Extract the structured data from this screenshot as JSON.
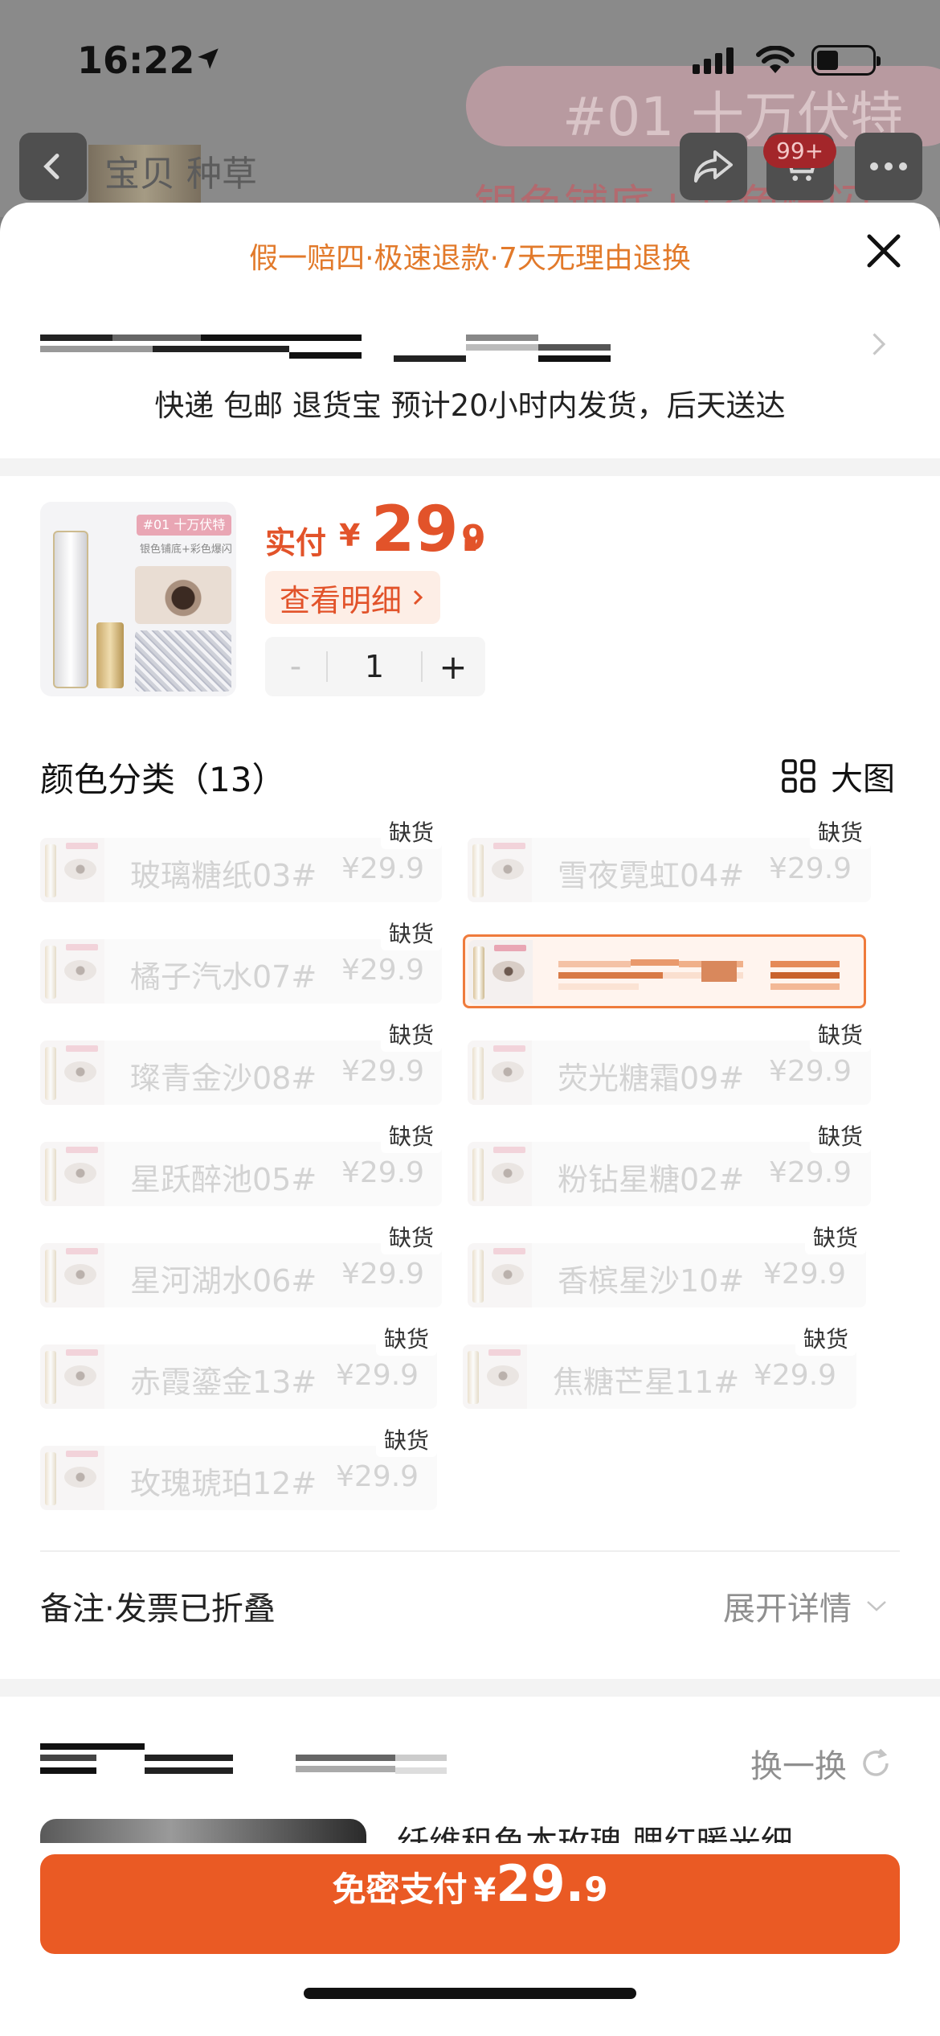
{
  "status_bar": {
    "time": "16:22"
  },
  "background_page": {
    "title": "宝贝 种草",
    "banner_text": "#01 十万伏特",
    "banner_subtext": "银色铺底+彩色爆闪",
    "cart_badge": "99+"
  },
  "sheet": {
    "guarantee": "假一赔四·极速退款·7天无理由退换",
    "delivery": "快递 包邮 退货宝 预计20小时内发货，后天送达",
    "product": {
      "thumb_tag": "#01 十万伏特",
      "thumb_subtag": "银色铺底+彩色爆闪",
      "paid_label": "实付",
      "currency": "¥",
      "price_int": "29.",
      "price_dec": "9",
      "detail_label": "查看明细",
      "quantity": "1",
      "minus": "-",
      "plus": "+"
    },
    "color_section": {
      "title": "颜色分类（13）",
      "big_image_label": "大图",
      "out_of_stock_label": "缺货",
      "options": [
        {
          "name": "玻璃糖纸03#",
          "price": "¥29.9",
          "out_of_stock": true
        },
        {
          "name": "雪夜霓虹04#",
          "price": "¥29.9",
          "out_of_stock": true
        },
        {
          "name": "橘子汽水07#",
          "price": "¥29.9",
          "out_of_stock": true
        },
        {
          "name": "",
          "price": "",
          "out_of_stock": false,
          "selected": true
        },
        {
          "name": "璨青金沙08#",
          "price": "¥29.9",
          "out_of_stock": true
        },
        {
          "name": "荧光糖霜09#",
          "price": "¥29.9",
          "out_of_stock": true
        },
        {
          "name": "星跃醉池05#",
          "price": "¥29.9",
          "out_of_stock": true
        },
        {
          "name": "粉钻星糖02#",
          "price": "¥29.9",
          "out_of_stock": true
        },
        {
          "name": "星河湖水06#",
          "price": "¥29.9",
          "out_of_stock": true
        },
        {
          "name": "香槟星沙10#",
          "price": "¥29.9",
          "out_of_stock": true
        },
        {
          "name": "赤霞鎏金13#",
          "price": "¥29.9",
          "out_of_stock": true
        },
        {
          "name": "焦糖芒星11#",
          "price": "¥29.9",
          "out_of_stock": true
        },
        {
          "name": "玫瑰琥珀12#",
          "price": "¥29.9",
          "out_of_stock": true
        }
      ]
    },
    "notes": {
      "label": "备注·发票已折叠",
      "expand_label": "展开详情"
    },
    "recommend": {
      "refresh_label": "换一换",
      "card_text": "纤维租鱼本玫瑰 腮红暖光细"
    },
    "pay_button": {
      "label": "免密支付",
      "currency": "¥",
      "price_int": "29.",
      "price_dec": "9"
    }
  },
  "colors": {
    "accent": "#ea5a24",
    "price": "#e2532a",
    "guarantee": "#e27a2b",
    "selected_border": "#ef7b3c"
  }
}
